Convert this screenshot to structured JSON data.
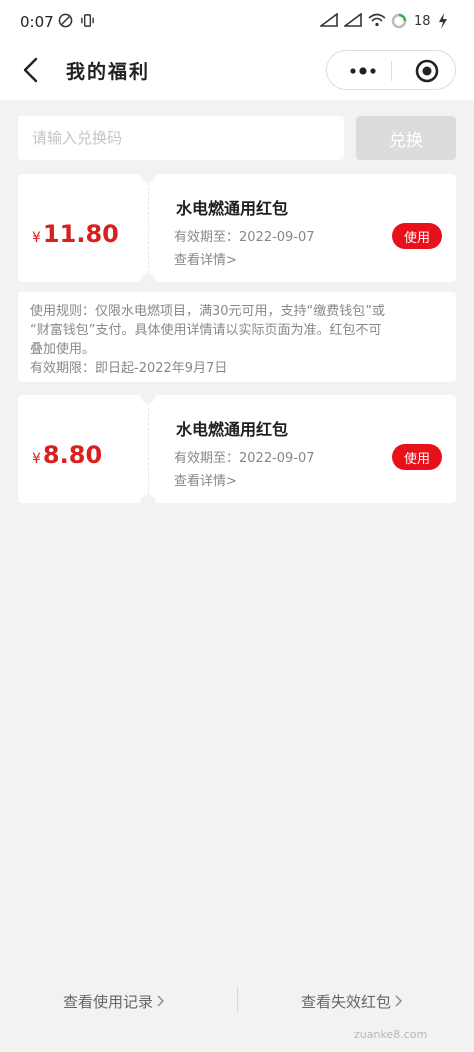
{
  "status_bar": {
    "time": "0:07",
    "battery": "18"
  },
  "header": {
    "title": "我的福利",
    "back_icon": "chevron-left-icon",
    "more_icon": "more-dots-icon",
    "close_icon": "target-close-icon"
  },
  "redeem": {
    "placeholder": "请输入兑换码",
    "button_label": "兑换"
  },
  "coupons": [
    {
      "currency": "¥",
      "amount": "11.80",
      "title": "水电燃通用红包",
      "expiry": "有效期至：2022-09-07",
      "detail_link": "查看详情>",
      "use_label": "使用"
    },
    {
      "currency": "¥",
      "amount": "8.80",
      "title": "水电燃通用红包",
      "expiry": "有效期至：2022-09-07",
      "detail_link": "查看详情>",
      "use_label": "使用"
    }
  ],
  "rules": {
    "line1": "使用规则：仅限水电燃项目，满30元可用，支持“缴费钱包”或",
    "line2": "“财富钱包”支付。具体使用详情请以实际页面为准。红包不可",
    "line3": "叠加使用。",
    "line4": "有效期限：即日起-2022年9月7日"
  },
  "footer": {
    "usage_history": "查看使用记录",
    "expired_packets": "查看失效红包",
    "watermark": "zuanke8.com"
  },
  "colors": {
    "accent_red": "#e8101a",
    "amount_red": "#d8201f",
    "background": "#f2f2f2",
    "disabled_button": "#dcdcdc"
  }
}
